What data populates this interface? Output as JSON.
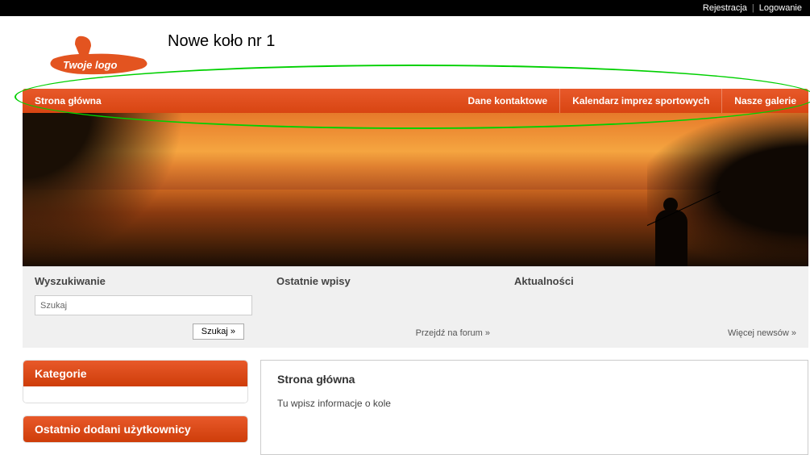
{
  "topbar": {
    "register": "Rejestracja",
    "login": "Logowanie"
  },
  "header": {
    "logo_text": "Twoje logo",
    "site_title": "Nowe koło nr 1"
  },
  "nav": {
    "home": "Strona główna",
    "contact": "Dane kontaktowe",
    "calendar": "Kalendarz imprez sportowych",
    "gallery": "Nasze galerie"
  },
  "columns": {
    "search": {
      "title": "Wyszukiwanie",
      "placeholder": "Szukaj",
      "button": "Szukaj »"
    },
    "recent": {
      "title": "Ostatnie wpisy",
      "link": "Przejdź na forum"
    },
    "news": {
      "title": "Aktualności",
      "link": "Więcej newsów"
    }
  },
  "sidebar": {
    "categories": "Kategorie",
    "recent_users": "Ostatnio dodani użytkownicy"
  },
  "content": {
    "title": "Strona główna",
    "body": "Tu wpisz informacje o kole"
  }
}
